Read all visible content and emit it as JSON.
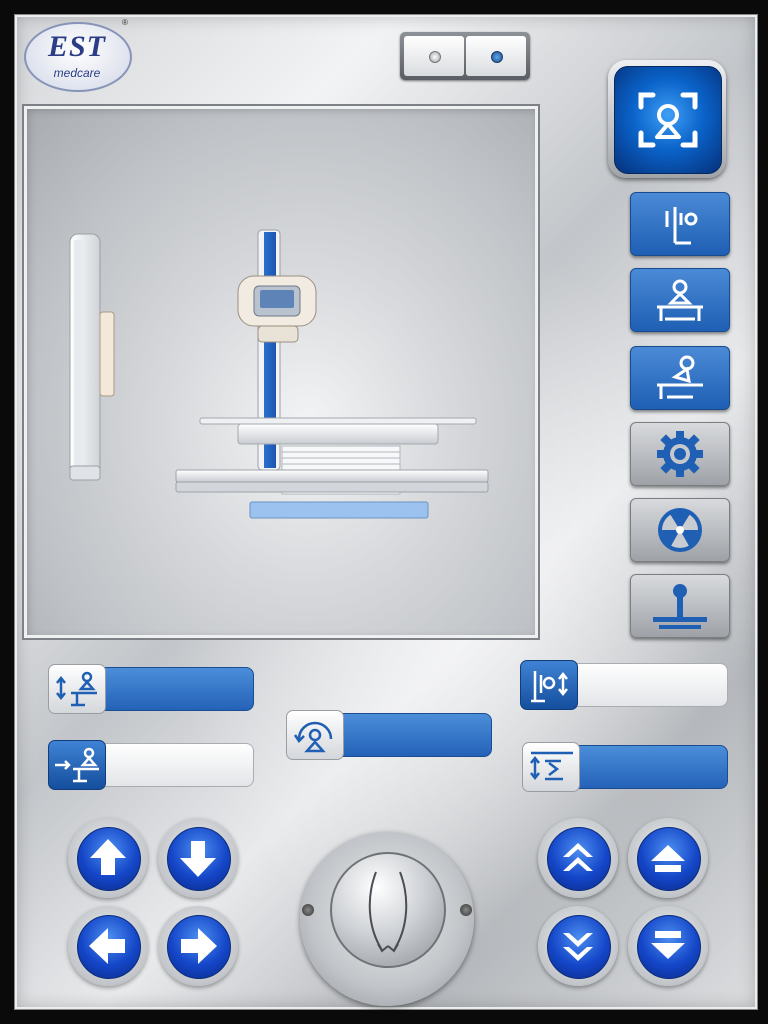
{
  "brand": {
    "name": "EST",
    "tagline": "medcare",
    "mark": "®"
  },
  "colors": {
    "accent_blue": "#1f5fb4",
    "button_blue": "#1446c8",
    "steel": "#c2c5c9",
    "active_blue": "#0a63c9"
  },
  "top_switch": {
    "left_icon": "off-indicator",
    "right_icon": "on-indicator"
  },
  "mode_button": {
    "icon": "patient-scan-icon"
  },
  "side_buttons": [
    {
      "icon": "vertical-bucky-icon",
      "style": "blue"
    },
    {
      "icon": "table-patient-icon",
      "style": "blue"
    },
    {
      "icon": "table-tilt-patient-icon",
      "style": "blue"
    },
    {
      "icon": "gear-icon",
      "style": "gray"
    },
    {
      "icon": "radiation-icon",
      "style": "gray"
    },
    {
      "icon": "joystick-icon",
      "style": "gray"
    }
  ],
  "sliders": [
    {
      "name": "table-height",
      "icon": "table-height-icon",
      "level": 1.0
    },
    {
      "name": "table-lateral",
      "icon": "table-lateral-icon",
      "level": 0.0
    },
    {
      "name": "tube-rotation",
      "icon": "tube-rotation-icon",
      "level": 1.0
    },
    {
      "name": "column-height",
      "icon": "column-height-icon",
      "level": 0.0
    },
    {
      "name": "sid-distance",
      "icon": "sid-distance-icon",
      "level": 1.0
    }
  ],
  "direction_buttons_left": [
    "arrow-up-icon",
    "arrow-down-icon",
    "arrow-left-icon",
    "arrow-right-icon"
  ],
  "direction_buttons_right": [
    "fast-up-icon",
    "step-up-icon",
    "fast-down-icon",
    "step-down-icon"
  ],
  "joystick": {
    "icon": "joystick-knob"
  }
}
